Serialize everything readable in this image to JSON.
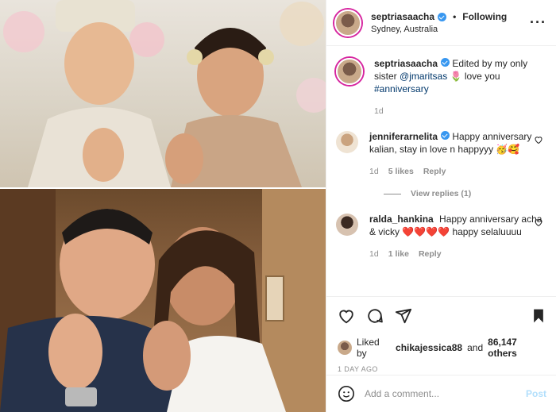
{
  "post": {
    "username": "septriasaacha",
    "follow_label": "Following",
    "location": "Sydney, Australia",
    "caption_text": "Edited by my only sister",
    "caption_mention": "@jmaritsas",
    "caption_emoji": "🌷",
    "caption_text2": "love you",
    "caption_hashtag": "#anniversary",
    "caption_time": "1d"
  },
  "comments": [
    {
      "username": "jenniferarnelita",
      "text": "Happy anniversary kalian, stay in love n happyyy 🥳🥰",
      "time": "1d",
      "likes": "5 likes",
      "reply": "Reply",
      "view_replies": "View replies (1)"
    },
    {
      "username": "ralda_hankina",
      "text": "Happy anniversary acha & vicky ❤️❤️❤️❤️ happy selaluuuu",
      "time": "1d",
      "likes": "1 like",
      "reply": "Reply"
    }
  ],
  "engagement": {
    "liked_by_prefix": "Liked by",
    "liked_by_user": "chikajessica88",
    "liked_by_and": "and",
    "liked_by_count": "86,147 others",
    "posted_ago": "1 DAY AGO"
  },
  "add_comment": {
    "placeholder": "Add a comment...",
    "post_label": "Post"
  },
  "icons": {
    "more": "more-options-icon",
    "verified": "verified-badge-icon",
    "like": "heart-icon",
    "comment": "comment-icon",
    "share": "share-icon",
    "save": "bookmark-icon",
    "emoji": "emoji-icon"
  },
  "colors": {
    "verified": "#3897f0",
    "post_disabled": "#b2dffc",
    "muted": "#8e8e8e",
    "text": "#262626"
  }
}
